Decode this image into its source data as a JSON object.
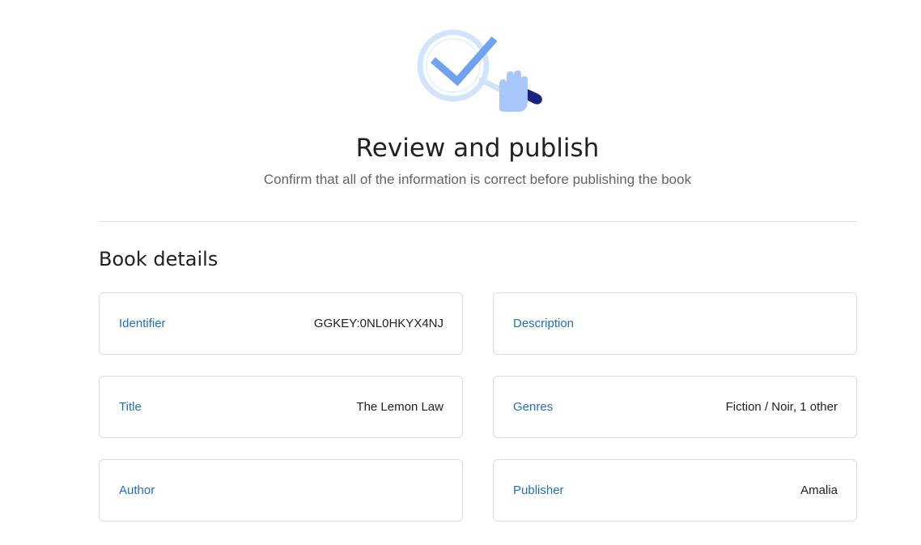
{
  "header": {
    "illustration_icon": "magnifier-checkmark-icon",
    "title": "Review and publish",
    "subtitle": "Confirm that all of the information is correct before publishing the book"
  },
  "section": {
    "title": "Book details"
  },
  "details": {
    "identifier": {
      "label": "Identifier",
      "value": "GGKEY:0NL0HKYX4NJ"
    },
    "description": {
      "label": "Description",
      "value": ""
    },
    "title": {
      "label": "Title",
      "value": "The Lemon Law"
    },
    "genres": {
      "label": "Genres",
      "value": "Fiction / Noir, 1 other"
    },
    "author": {
      "label": "Author",
      "value": ""
    },
    "publisher": {
      "label": "Publisher",
      "value": "Amalia"
    }
  },
  "colors": {
    "label_blue": "#1f6fbf",
    "divider": "#dadce0",
    "card_border": "#dadce0",
    "illustration_light_blue": "#cfe0fb",
    "illustration_blue": "#6fa3ef",
    "illustration_navy": "#1a237e"
  }
}
